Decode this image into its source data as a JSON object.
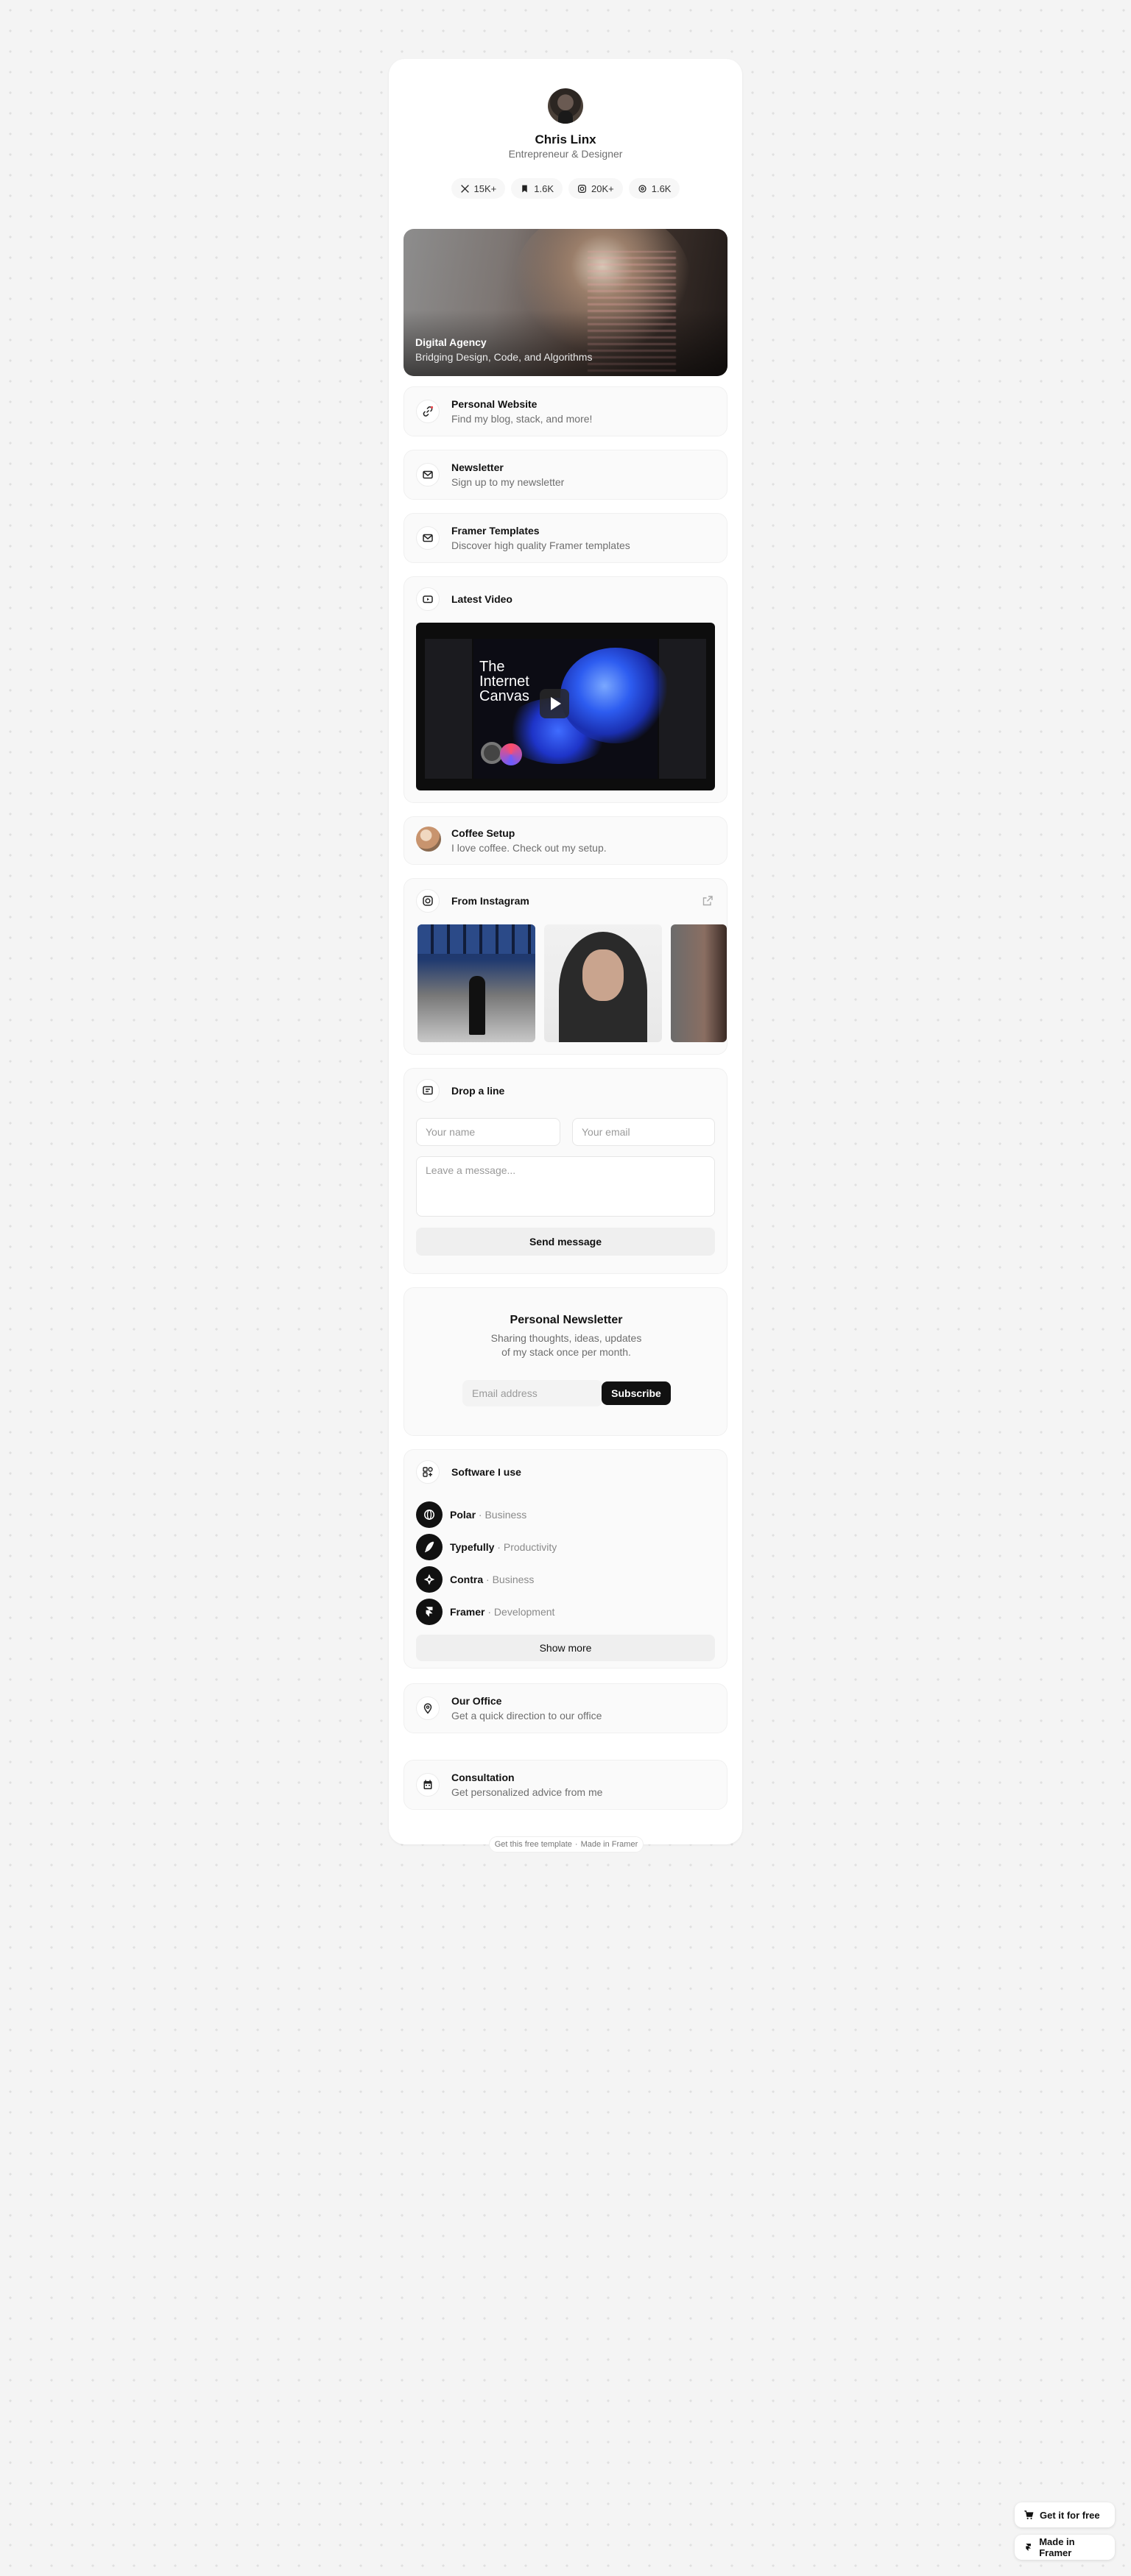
{
  "profile": {
    "name": "Chris Linx",
    "role": "Entrepreneur & Designer",
    "socials": [
      {
        "icon": "x-icon",
        "count": "15K+"
      },
      {
        "icon": "bookmark-icon",
        "count": "1.6K"
      },
      {
        "icon": "instagram-icon",
        "count": "20K+"
      },
      {
        "icon": "threads-icon",
        "count": "1.6K"
      }
    ]
  },
  "hero": {
    "title": "Digital Agency",
    "subtitle": "Bridging Design, Code, and Algorithms"
  },
  "links": {
    "website": {
      "title": "Personal Website",
      "subtitle": "Find my blog, stack, and more!",
      "icon": "link-icon"
    },
    "newsletter": {
      "title": "Newsletter",
      "subtitle": "Sign up to my newsletter",
      "icon": "mail-icon"
    },
    "templates": {
      "title": "Framer Templates",
      "subtitle": "Discover high quality Framer templates",
      "icon": "mail-icon"
    }
  },
  "video": {
    "title": "Latest Video",
    "icon": "youtube-icon",
    "thumbnail_text_1": "The",
    "thumbnail_text_2": "Internet",
    "thumbnail_text_3": "Canvas"
  },
  "coffee": {
    "title": "Coffee Setup",
    "subtitle": "I love coffee. Check out my setup."
  },
  "instagram": {
    "title": "From Instagram",
    "icon": "instagram-icon"
  },
  "contact": {
    "title": "Drop a line",
    "name_placeholder": "Your name",
    "email_placeholder": "Your email",
    "message_placeholder": "Leave a message...",
    "send_label": "Send message"
  },
  "personal_newsletter": {
    "title": "Personal Newsletter",
    "line1": "Sharing thoughts, ideas, updates",
    "line2": "of my stack once per month.",
    "email_placeholder": "Email address",
    "subscribe_label": "Subscribe"
  },
  "software": {
    "title": "Software I use",
    "items": [
      {
        "name": "Polar",
        "sep": " · ",
        "category": "Business",
        "icon": "polar-icon"
      },
      {
        "name": "Typefully",
        "sep": " · ",
        "category": "Productivity",
        "icon": "quill-icon"
      },
      {
        "name": "Contra",
        "sep": " · ",
        "category": "Business",
        "icon": "contra-icon"
      },
      {
        "name": "Framer",
        "sep": " · ",
        "category": "Development",
        "icon": "framer-icon"
      }
    ],
    "show_more_label": "Show more"
  },
  "office": {
    "title": "Our Office",
    "subtitle": "Get a quick direction to our office",
    "icon": "map-pin-icon"
  },
  "consultation": {
    "title": "Consultation",
    "subtitle": "Get personalized advice from me",
    "icon": "calendar-icon"
  },
  "footer": {
    "template_link": "Get this free template",
    "dot": "·",
    "made_in": "Made in Framer"
  },
  "corner": {
    "get_free": "Get it for free",
    "made_in_framer": "Made in Framer"
  }
}
